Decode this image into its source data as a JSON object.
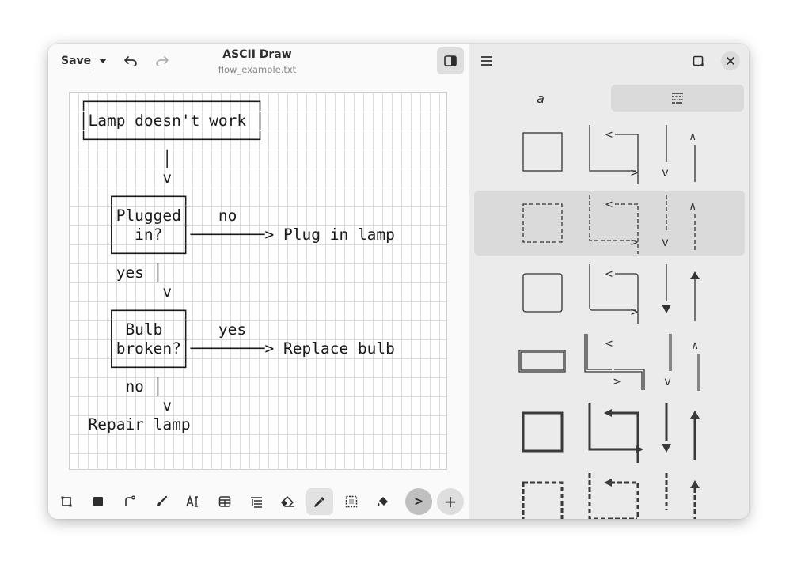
{
  "header": {
    "save_label": "Save",
    "title": "ASCII Draw",
    "filename": "flow_example.txt"
  },
  "canvas": {
    "ascii_art": " ┌──────────────────┐\n │Lamp doesn't work │\n └──────────────────┘\n          │\n          v\n    ┌───────┐\n    │Plugged│   no\n    │  in?  │────────> Plug in lamp\n    └───────┘\n     yes │\n          v\n    ┌───────┐\n    │ Bulb  │   yes\n    │broken?│────────> Replace bulb\n    └───────┘\n      no │\n          v\n  Repair lamp",
    "grid_cell": "12x24"
  },
  "toolbar": {
    "tools": [
      {
        "name": "rectangle-tool-icon",
        "active": false
      },
      {
        "name": "filled-rectangle-tool-icon",
        "active": false
      },
      {
        "name": "line-tool-icon",
        "active": false
      },
      {
        "name": "freehand-brush-icon",
        "active": false
      },
      {
        "name": "text-tool-icon",
        "active": false
      },
      {
        "name": "table-tool-icon",
        "active": false
      },
      {
        "name": "tree-list-tool-icon",
        "active": false
      },
      {
        "name": "eraser-icon",
        "active": false
      },
      {
        "name": "color-picker-icon",
        "active": true
      },
      {
        "name": "selection-tool-icon",
        "active": false
      },
      {
        "name": "fill-tool-icon",
        "active": false
      }
    ],
    "next_label": ">",
    "add_label": "+"
  },
  "sidebar": {
    "tabs": [
      {
        "name": "tab-text-characters",
        "label": "a",
        "selected": false
      },
      {
        "name": "tab-line-styles",
        "label": "",
        "selected": true
      }
    ],
    "styles": [
      {
        "name": "thin-solid",
        "selected": false
      },
      {
        "name": "thin-dashed",
        "selected": true
      },
      {
        "name": "rounded-arrows",
        "selected": false
      },
      {
        "name": "double-line",
        "selected": false
      },
      {
        "name": "thick-solid",
        "selected": false
      },
      {
        "name": "thick-dashed",
        "selected": false
      }
    ]
  },
  "colors": {
    "window_bg": "#fafafa",
    "sidebar_bg": "#ebebeb",
    "selection_bg": "#dadada",
    "grid_line": "#dcdcdc"
  }
}
